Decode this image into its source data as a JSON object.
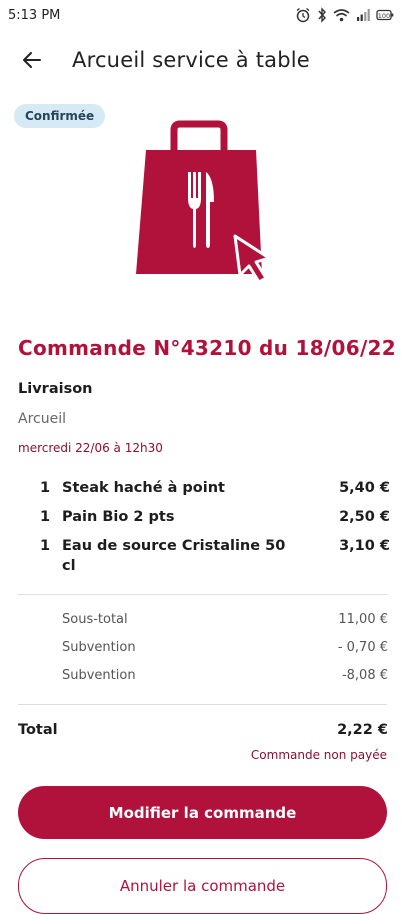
{
  "status_bar": {
    "time": "5:13 PM",
    "battery": "100"
  },
  "header": {
    "title": "Arcueil service à table"
  },
  "order": {
    "status": "Confirmée",
    "title": "Commande N°43210 du 18/06/22",
    "mode": "Livraison",
    "place": "Arcueil",
    "slot": "mercredi 22/06 à 12h30",
    "items": [
      {
        "qty": "1",
        "name": "Steak haché à point",
        "price": "5,40 €"
      },
      {
        "qty": "1",
        "name": "Pain Bio 2 pts",
        "price": "2,50 €"
      },
      {
        "qty": "1",
        "name": "Eau de source Cristaline 50 cl",
        "price": "3,10 €"
      }
    ],
    "subtotals": [
      {
        "label": "Sous-total",
        "value": "11,00 €"
      },
      {
        "label": "Subvention",
        "value": "- 0,70 €"
      },
      {
        "label": "Subvention",
        "value": "-8,08 €"
      }
    ],
    "total_label": "Total",
    "total_value": "2,22 €",
    "payment_status": "Commande non payée"
  },
  "actions": {
    "modify": "Modifier la commande",
    "cancel": "Annuler la commande"
  },
  "colors": {
    "accent": "#b0123c",
    "badge_bg": "#d6eaf5"
  }
}
